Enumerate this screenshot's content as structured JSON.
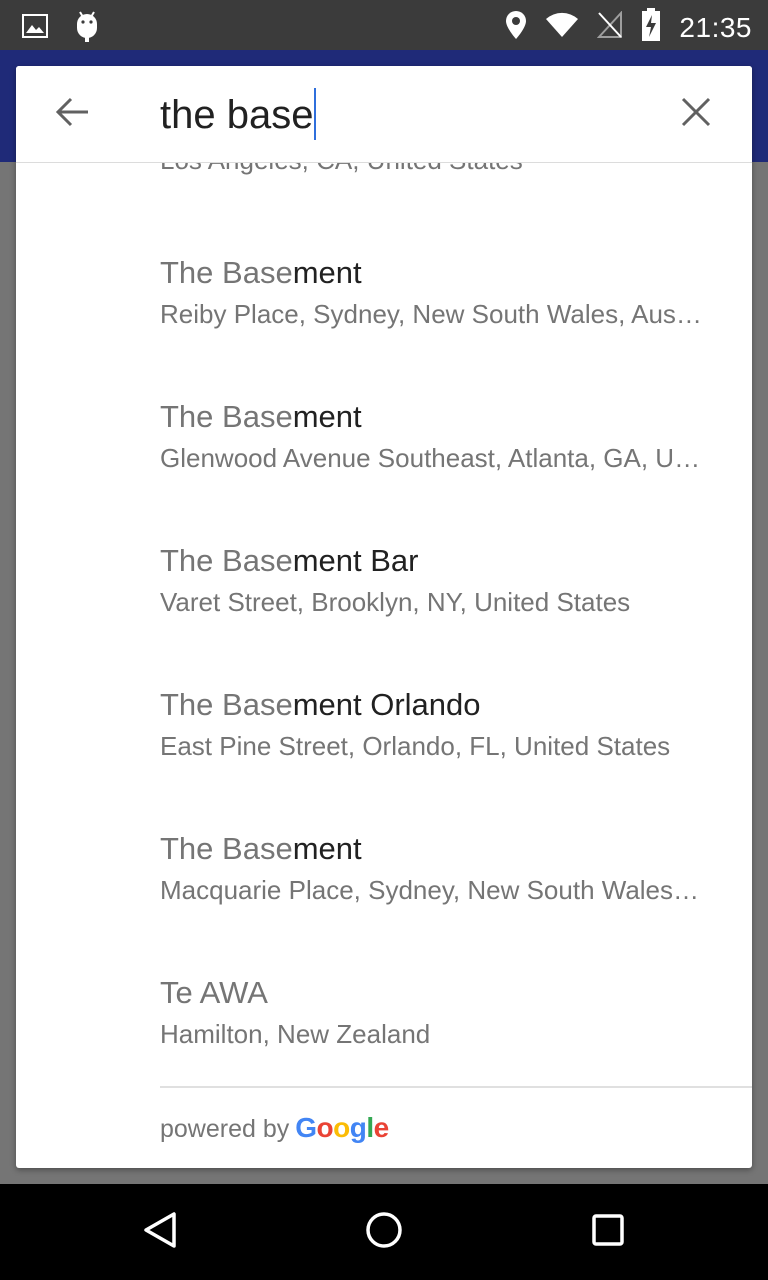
{
  "status_bar": {
    "time": "21:35",
    "icons": [
      "gallery-icon",
      "android-debug-icon",
      "location-icon",
      "wifi-icon",
      "no-sim-icon",
      "battery-charging-icon"
    ]
  },
  "search": {
    "query": "the base",
    "back_icon": "arrow-back-icon",
    "clear_icon": "close-icon"
  },
  "results": {
    "partial_subtitle": "Los Angeles, CA, United States",
    "items": [
      {
        "match": "The Base",
        "rest": "ment",
        "subtitle": "Reiby Place, Sydney, New South Wales, Aus…"
      },
      {
        "match": "The Base",
        "rest": "ment",
        "subtitle": "Glenwood Avenue Southeast, Atlanta, GA, U…"
      },
      {
        "match": "The Base",
        "rest": "ment Bar",
        "subtitle": "Varet Street, Brooklyn, NY, United States"
      },
      {
        "match": "The Base",
        "rest": "ment Orlando",
        "subtitle": "East Pine Street, Orlando, FL, United States"
      },
      {
        "match": "The Base",
        "rest": "ment",
        "subtitle": "Macquarie Place, Sydney, New South Wales…"
      },
      {
        "match": "Te AWA",
        "rest": "",
        "subtitle": "Hamilton, New Zealand"
      }
    ]
  },
  "footer": {
    "powered_by": "powered by",
    "google_letters": [
      {
        "ch": "G",
        "color": "#4285F4"
      },
      {
        "ch": "o",
        "color": "#EA4335"
      },
      {
        "ch": "o",
        "color": "#FBBC05"
      },
      {
        "ch": "g",
        "color": "#4285F4"
      },
      {
        "ch": "l",
        "color": "#34A853"
      },
      {
        "ch": "e",
        "color": "#EA4335"
      }
    ]
  },
  "nav_bar": {
    "buttons": [
      "back-triangle-icon",
      "home-circle-icon",
      "recents-square-icon"
    ]
  },
  "colors": {
    "status_bar": "#3b3b3b",
    "app_bar": "#1f2a78",
    "scrim": "#757575",
    "caret": "#2f6fdc"
  }
}
